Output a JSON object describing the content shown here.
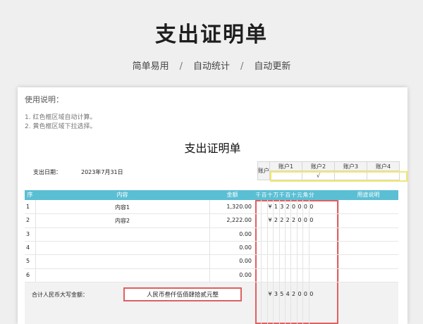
{
  "hero": {
    "title": "支出证明单",
    "features": [
      "简单易用",
      "自动统计",
      "自动更新"
    ],
    "separator": "/"
  },
  "instructions": {
    "title": "使用说明：",
    "items": [
      "1. 红色框区域自动计算。",
      "2. 黄色框区域下拉选择。"
    ]
  },
  "form": {
    "title": "支出证明单",
    "date_label": "支出日期：",
    "date_value": "2023年7月31日",
    "account": {
      "label": "账户",
      "headers": [
        "账户1",
        "账户2",
        "账户3",
        "账户4"
      ],
      "selected_index": 1,
      "check_mark": "√"
    },
    "table": {
      "headers": {
        "seq": "序",
        "content": "内容",
        "amount": "金额",
        "purpose": "用途说明"
      },
      "digit_headers": [
        "千",
        "百",
        "十",
        "万",
        "千",
        "百",
        "十",
        "元",
        "角",
        "分"
      ],
      "rows": [
        {
          "seq": "1",
          "content": "内容1",
          "amount": "1,320.00",
          "digits": [
            "",
            "",
            "¥",
            "1",
            "3",
            "2",
            "0",
            "0",
            "0",
            "0"
          ]
        },
        {
          "seq": "2",
          "content": "内容2",
          "amount": "2,222.00",
          "digits": [
            "",
            "",
            "¥",
            "2",
            "2",
            "2",
            "2",
            "0",
            "0",
            "0"
          ]
        },
        {
          "seq": "3",
          "content": "",
          "amount": "0.00",
          "digits": [
            "",
            "",
            "",
            "",
            "",
            "",
            "",
            "",
            "",
            ""
          ]
        },
        {
          "seq": "4",
          "content": "",
          "amount": "0.00",
          "digits": [
            "",
            "",
            "",
            "",
            "",
            "",
            "",
            "",
            "",
            ""
          ]
        },
        {
          "seq": "5",
          "content": "",
          "amount": "0.00",
          "digits": [
            "",
            "",
            "",
            "",
            "",
            "",
            "",
            "",
            "",
            ""
          ]
        },
        {
          "seq": "6",
          "content": "",
          "amount": "0.00",
          "digits": [
            "",
            "",
            "",
            "",
            "",
            "",
            "",
            "",
            "",
            ""
          ]
        }
      ],
      "total": {
        "label": "合计人民币大写金额：",
        "capital": "人民币叁仟伍佰肆拾贰元整",
        "digits": [
          "",
          "",
          "¥",
          "3",
          "5",
          "4",
          "2",
          "0",
          "0",
          "0"
        ]
      }
    }
  },
  "colors": {
    "header": "#5bbfd4",
    "red_frame": "#e06060",
    "yellow_frame": "#f1e86a"
  }
}
